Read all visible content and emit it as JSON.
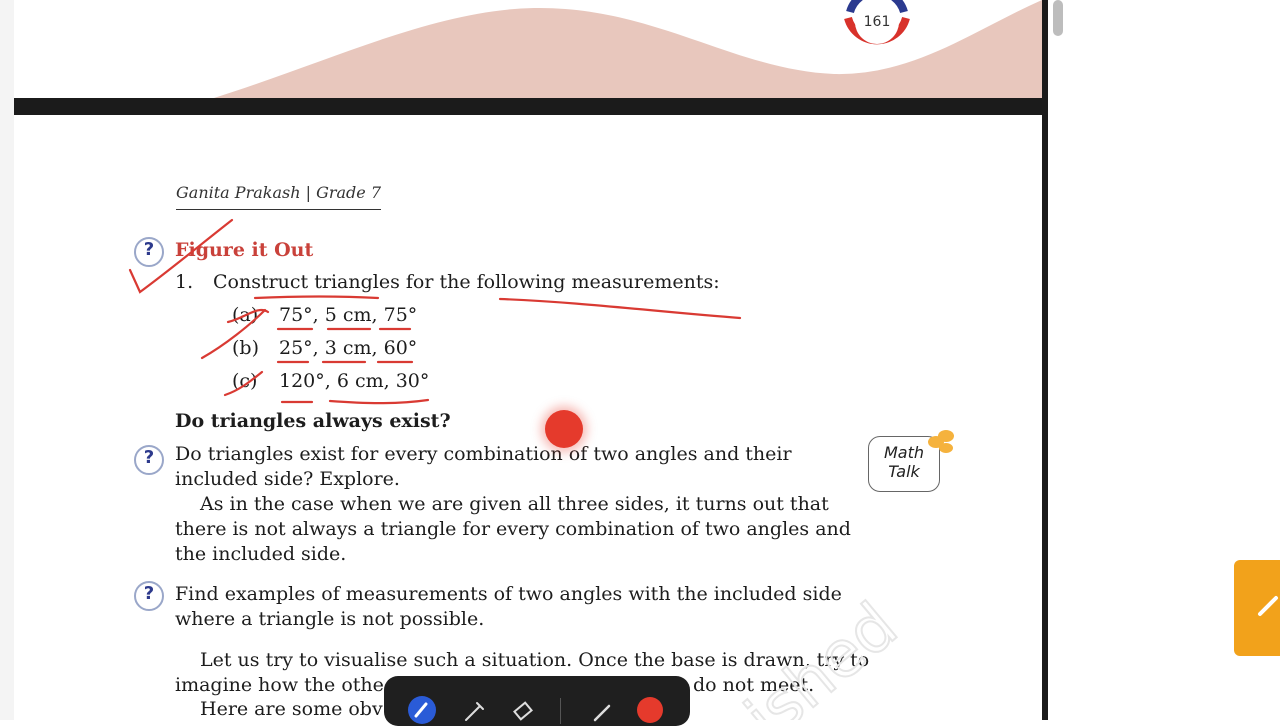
{
  "previous_page": {
    "page_number": "161"
  },
  "page": {
    "running_head": "Ganita Prakash | Grade 7",
    "figure_it_out": {
      "title": "Figure it Out",
      "question_number": "1.",
      "question": "Construct triangles for the following measurements:",
      "items": [
        {
          "label": "(a)",
          "value": "75°, 5 cm, 75°"
        },
        {
          "label": "(b)",
          "value": "25°, 3 cm, 60°"
        },
        {
          "label": "(c)",
          "value": "120°, 6 cm, 30°"
        }
      ]
    },
    "section_heading": "Do triangles always exist?",
    "explore_question": [
      "Do triangles exist for every combination of two angles and their",
      "included side? Explore."
    ],
    "paragraph1": [
      "As in the case when we are given all three sides, it turns out that",
      "there is not always a triangle for every combination of two angles and",
      "the included side."
    ],
    "find_question": [
      "Find examples of measurements of two angles with the included side",
      "where a triangle is not possible."
    ],
    "paragraph2": {
      "line1": "Let us try to visualise such a situation. Once the base is drawn, try to",
      "line2_start": "imagine how the othe",
      "line2_end": "do not meet.",
      "line3": "Here are some obv"
    },
    "math_talk": [
      "Math",
      "Talk"
    ],
    "qmark_symbol": "?"
  },
  "annotation_colors": {
    "ink": "#d93a33",
    "record": "#e53a2c",
    "side_tab": "#f2a21b",
    "wave": "#e8c7bd"
  },
  "toolbar": {
    "tools": [
      "pen-icon",
      "pencil-icon",
      "eraser-icon",
      "line-icon",
      "color-dot-icon"
    ]
  }
}
